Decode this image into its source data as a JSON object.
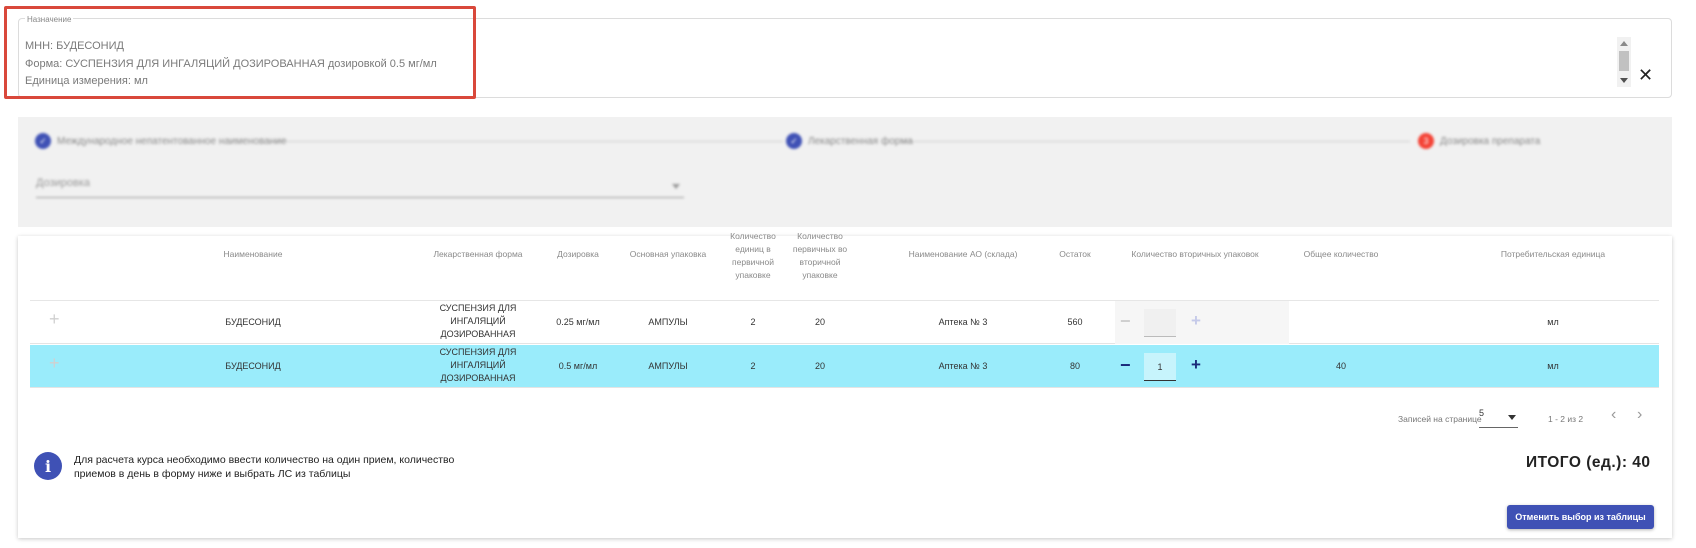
{
  "assignment": {
    "legend": "Назначение",
    "line1": "МНН: БУДЕСОНИД",
    "line2": "Форма: СУСПЕНЗИЯ ДЛЯ ИНГАЛЯЦИЙ ДОЗИРОВАННАЯ дозировкой 0.5 мг/мл",
    "line3": "Единица измерения: мл",
    "clear_icon": "close-icon"
  },
  "stepper": {
    "steps": [
      {
        "label": "Международное непатентованное наименование",
        "state": "done"
      },
      {
        "label": "Лекарственная форма",
        "state": "done"
      },
      {
        "label": "Дозировка препарата",
        "state": "active",
        "number": "3"
      }
    ],
    "dosage_placeholder": "Дозировка"
  },
  "table": {
    "headers": {
      "name": "Наименование",
      "form": "Лекарственная форма",
      "dosage": "Дозировка",
      "package": "Основная упаковка",
      "units_in_primary": [
        "Количество",
        "единиц в",
        "первичной",
        "упаковке"
      ],
      "primary_in_secondary": [
        "Количество",
        "первичных во",
        "вторичной",
        "упаковке"
      ],
      "warehouse": "Наименование АО (склада)",
      "stock": "Остаток",
      "secondary_qty": "Количество вторичных упаковок",
      "total_qty": "Общее количество",
      "consumer_unit": "Потребительская единица"
    },
    "rows": [
      {
        "name": "БУДЕСОНИД",
        "form": [
          "СУСПЕНЗИЯ ДЛЯ",
          "ИНГАЛЯЦИЙ",
          "ДОЗИРОВАННАЯ"
        ],
        "dosage": "0.25 мг/мл",
        "package": "АМПУЛЫ",
        "units_in_primary": "2",
        "primary_in_secondary": "20",
        "warehouse": "Аптека № 3",
        "stock": "560",
        "qty": "",
        "total": "",
        "unit": "мл",
        "selected": false
      },
      {
        "name": "БУДЕСОНИД",
        "form": [
          "СУСПЕНЗИЯ ДЛЯ",
          "ИНГАЛЯЦИЙ",
          "ДОЗИРОВАННАЯ"
        ],
        "dosage": "0.5 мг/мл",
        "package": "АМПУЛЫ",
        "units_in_primary": "2",
        "primary_in_secondary": "20",
        "warehouse": "Аптека № 3",
        "stock": "80",
        "qty": "1",
        "total": "40",
        "unit": "мл",
        "selected": true
      }
    ],
    "pagination": {
      "rows_per_page_label": "Записей на странице",
      "rows_per_page": "5",
      "range": "1 - 2 из 2"
    }
  },
  "info": {
    "text": "Для расчета курса необходимо ввести количество на один прием, количество приемов в день в форму ниже и выбрать ЛС из таблицы",
    "total": "ИТОГО (ед.): 40",
    "cancel_button": "Отменить выбор из таблицы"
  },
  "colors": {
    "accent": "#3f51b5",
    "selected_row": "#9aecfb",
    "highlight_border": "#d9483b",
    "active_step": "#f44336"
  }
}
